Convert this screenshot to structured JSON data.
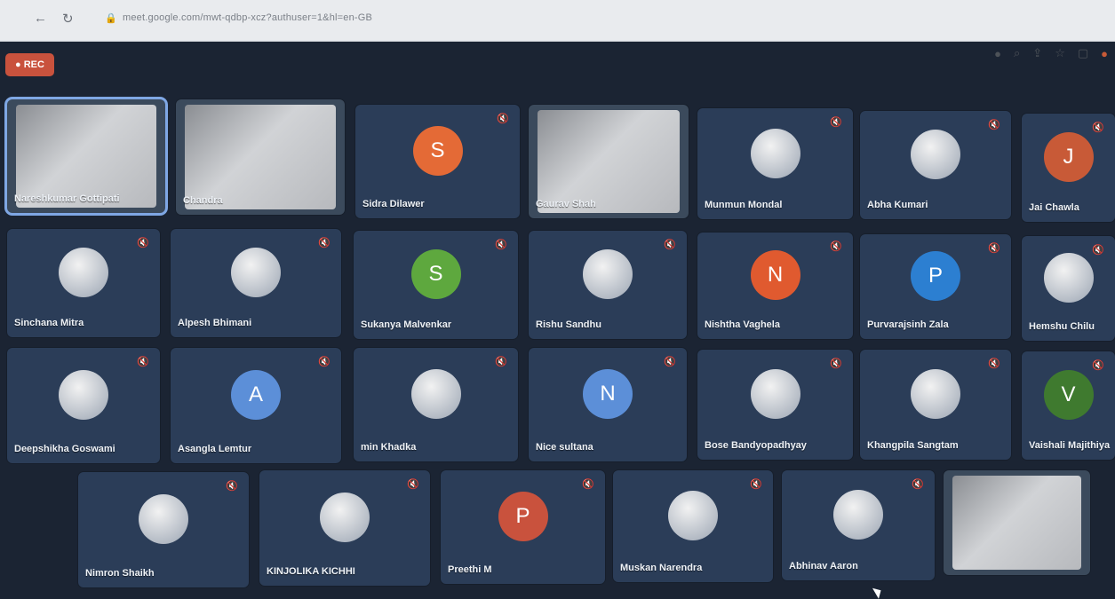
{
  "browser": {
    "back": "←",
    "reload": "↻",
    "lock": "🔒",
    "url": "meet.google.com/mwt-qdbp-xcz?authuser=1&hl=en-GB"
  },
  "toolbar_icons": [
    "camera",
    "zoom",
    "share",
    "star",
    "extension",
    "profile"
  ],
  "rec": {
    "label": "REC"
  },
  "participants": [
    {
      "name": "Nareshkumar Gottipati",
      "type": "video",
      "active": true
    },
    {
      "name": "Chandra",
      "type": "video"
    },
    {
      "name": "Sidra Dilawer",
      "initial": "S",
      "color": "#e46a36"
    },
    {
      "name": "Gaurav Shah",
      "type": "video"
    },
    {
      "name": "Munmun Mondal",
      "pic": true
    },
    {
      "name": "Abha Kumari",
      "pic": true
    },
    {
      "name": "Jai Chawla",
      "initial": "J",
      "color": "#c85a37"
    },
    {
      "name": "Sinchana Mitra",
      "pic": true
    },
    {
      "name": "Alpesh Bhimani",
      "pic": true
    },
    {
      "name": "Sukanya Malvenkar",
      "initial": "S",
      "color": "#5ea83e"
    },
    {
      "name": "Rishu Sandhu",
      "pic": true
    },
    {
      "name": "Nishtha Vaghela",
      "initial": "N",
      "color": "#e05a2f"
    },
    {
      "name": "Purvarajsinh Zala",
      "initial": "P",
      "color": "#2c7fd1"
    },
    {
      "name": "Hemshu Chilu",
      "pic": true
    },
    {
      "name": "Deepshikha Goswami",
      "pic": true
    },
    {
      "name": "Asangla Lemtur",
      "initial": "A",
      "color": "#5c8fd8"
    },
    {
      "name": "min Khadka",
      "pic": true
    },
    {
      "name": "Nice sultana",
      "initial": "N",
      "color": "#5c8fd8"
    },
    {
      "name": "Bose Bandyopadhyay",
      "pic": true
    },
    {
      "name": "Khangpila Sangtam",
      "pic": true
    },
    {
      "name": "Vaishali Majithiya",
      "initial": "V",
      "color": "#3f7a2f"
    },
    {
      "name": "Nimron Shaikh",
      "pic": true
    },
    {
      "name": "KINJOLIKA KICHHI",
      "pic": true
    },
    {
      "name": "Preethi M",
      "initial": "P",
      "color": "#c9523d"
    },
    {
      "name": "Muskan Narendra",
      "pic": true
    },
    {
      "name": "Abhinav Aaron",
      "pic": true
    },
    {
      "name": "",
      "type": "video"
    }
  ]
}
